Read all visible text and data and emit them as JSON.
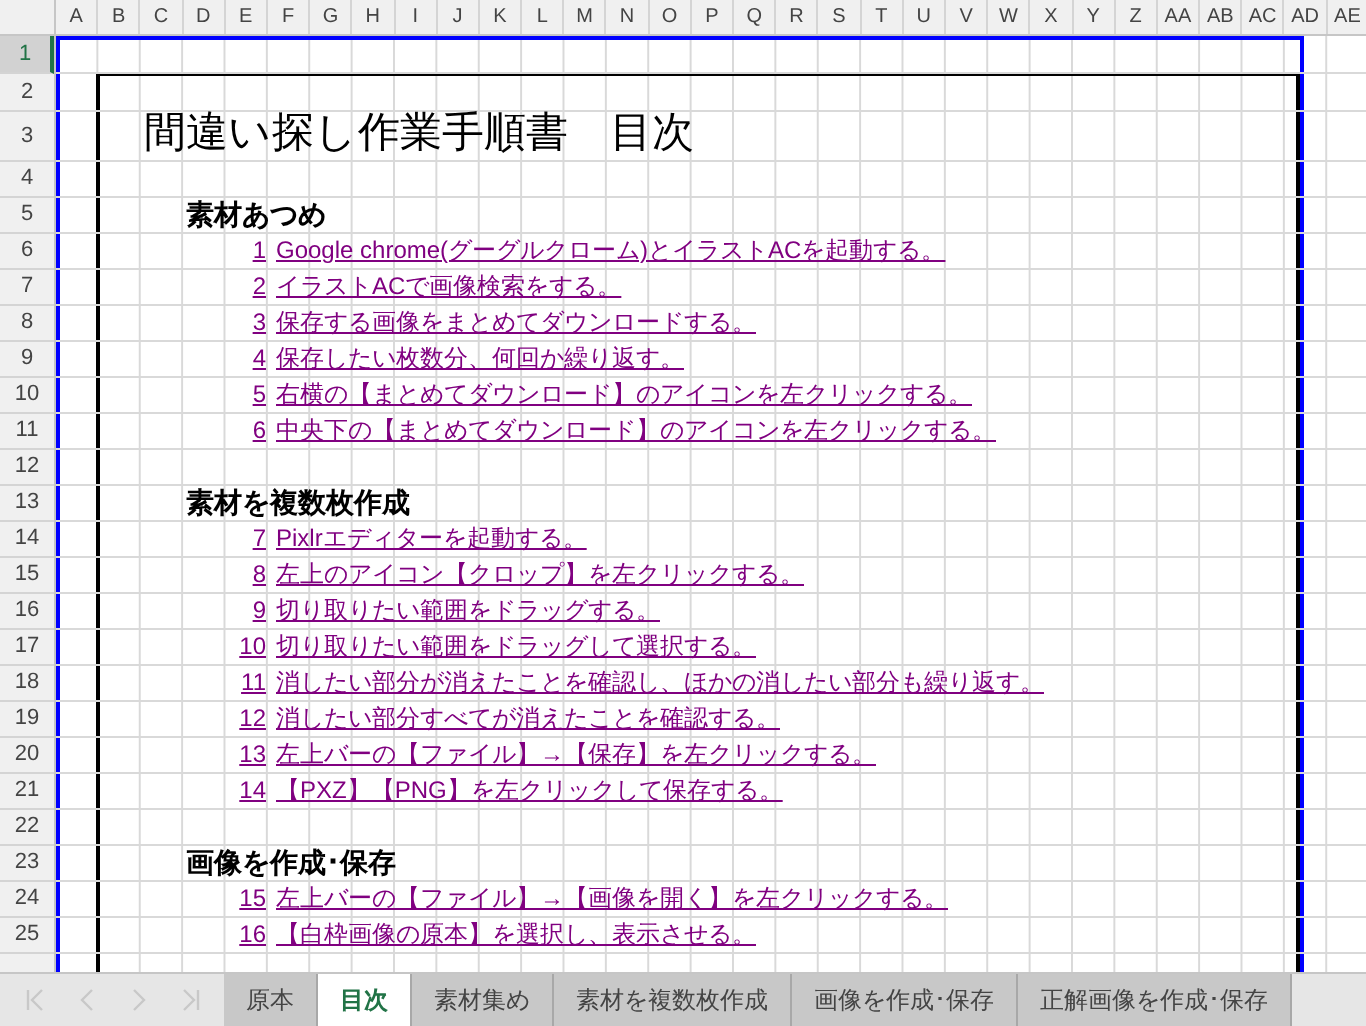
{
  "column_headers": [
    "A",
    "B",
    "C",
    "D",
    "E",
    "F",
    "G",
    "H",
    "I",
    "J",
    "K",
    "L",
    "M",
    "N",
    "O",
    "P",
    "Q",
    "R",
    "S",
    "T",
    "U",
    "V",
    "W",
    "X",
    "Y",
    "Z",
    "AA",
    "AB",
    "AC",
    "AD",
    "AE"
  ],
  "row_headers": [
    {
      "label": "1",
      "selected": true
    },
    {
      "label": "2",
      "selected": false
    },
    {
      "label": "3",
      "selected": false
    },
    {
      "label": "4",
      "selected": false
    },
    {
      "label": "5",
      "selected": false
    },
    {
      "label": "6",
      "selected": false
    },
    {
      "label": "7",
      "selected": false
    },
    {
      "label": "8",
      "selected": false
    },
    {
      "label": "9",
      "selected": false
    },
    {
      "label": "10",
      "selected": false
    },
    {
      "label": "11",
      "selected": false
    },
    {
      "label": "12",
      "selected": false
    },
    {
      "label": "13",
      "selected": false
    },
    {
      "label": "14",
      "selected": false
    },
    {
      "label": "15",
      "selected": false
    },
    {
      "label": "16",
      "selected": false
    },
    {
      "label": "17",
      "selected": false
    },
    {
      "label": "18",
      "selected": false
    },
    {
      "label": "19",
      "selected": false
    },
    {
      "label": "20",
      "selected": false
    },
    {
      "label": "21",
      "selected": false
    },
    {
      "label": "22",
      "selected": false
    },
    {
      "label": "23",
      "selected": false
    },
    {
      "label": "24",
      "selected": false
    },
    {
      "label": "25",
      "selected": false
    }
  ],
  "title": "間違い探し作業手順書　目次",
  "sections": [
    {
      "heading": "素材あつめ",
      "steps": [
        {
          "number": "1",
          "text": "Google chrome(グーグルクローム)とイラストACを起動する。"
        },
        {
          "number": "2",
          "text": "イラストACで画像検索をする。"
        },
        {
          "number": "3",
          "text": "保存する画像をまとめてダウンロードする。"
        },
        {
          "number": "4",
          "text": "保存したい枚数分、何回か繰り返す。"
        },
        {
          "number": "5",
          "text": "右横の【まとめてダウンロード】のアイコンを左クリックする。"
        },
        {
          "number": "6",
          "text": "中央下の【まとめてダウンロード】のアイコンを左クリックする。"
        }
      ]
    },
    {
      "heading": "素材を複数枚作成",
      "steps": [
        {
          "number": "7",
          "text": "Pixlrエディターを起動する。"
        },
        {
          "number": "8",
          "text": "左上のアイコン【クロップ】を左クリックする。"
        },
        {
          "number": "9",
          "text": "切り取りたい範囲をドラッグする。"
        },
        {
          "number": "10",
          "text": "切り取りたい範囲をドラッグして選択する。"
        },
        {
          "number": "11",
          "text": "消したい部分が消えたことを確認し、ほかの消したい部分も繰り返す。"
        },
        {
          "number": "12",
          "text": "消したい部分すべてが消えたことを確認する。"
        },
        {
          "number": "13",
          "text": "左上バーの【ファイル】→【保存】を左クリックする。"
        },
        {
          "number": "14",
          "text": "【PXZ】【PNG】を左クリックして保存する。"
        }
      ]
    },
    {
      "heading": "画像を作成･保存",
      "steps": [
        {
          "number": "15",
          "text": "左上バーの【ファイル】→【画像を開く】を左クリックする。"
        },
        {
          "number": "16",
          "text": "【白枠画像の原本】を選択し、表示させる。"
        }
      ]
    }
  ],
  "sheet_tabs": [
    {
      "label": "原本",
      "selected": false
    },
    {
      "label": "目次",
      "selected": true
    },
    {
      "label": "素材集め",
      "selected": false
    },
    {
      "label": "素材を複数枚作成",
      "selected": false
    },
    {
      "label": "画像を作成･保存",
      "selected": false
    },
    {
      "label": "正解画像を作成･保存",
      "selected": false
    }
  ]
}
